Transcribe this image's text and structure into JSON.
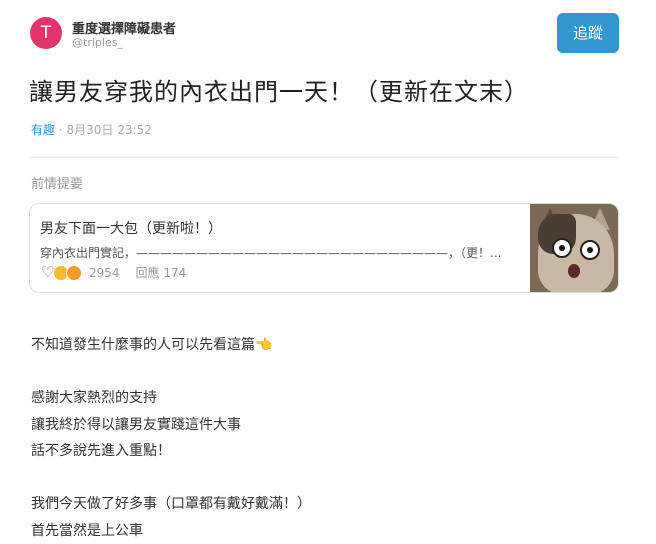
{
  "author": {
    "avatar_letter": "T",
    "name": "重度選擇障礙患者",
    "handle": "@triples_"
  },
  "follow_label": "追蹤",
  "post": {
    "title": "讓男友穿我的內衣出門一天！（更新在文末）",
    "board": "有趣",
    "date": "8月30日 23:52"
  },
  "section_label": "前情提要",
  "linked_card": {
    "title": "男友下面一大包（更新啦！）",
    "excerpt": "穿內衣出門實記，——————————————————————————，（更！...",
    "reactions": [
      "heart-reaction-icon",
      "haha-reaction-icon",
      "wow-reaction-icon"
    ],
    "reaction_count": "2954",
    "replies": "回應 174"
  },
  "body_lines": [
    "不知道發生什麼事的人可以先看這篇👈",
    "",
    "感謝大家熱烈的支持",
    "讓我終於得以讓男友實踐這件大事",
    "話不多說先進入重點！",
    "",
    "我們今天做了好多事（口罩都有戴好戴滿！）",
    "首先當然是上公車"
  ],
  "colors": {
    "accent": "#3397cf",
    "avatar": "#e2336b"
  }
}
